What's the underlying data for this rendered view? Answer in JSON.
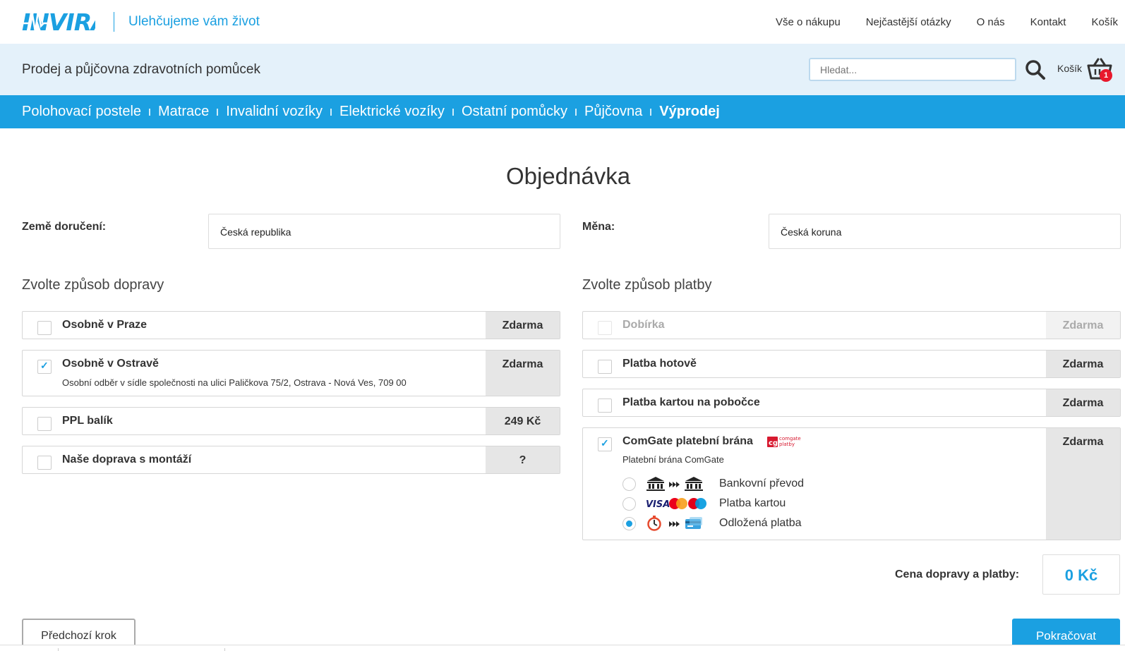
{
  "header": {
    "logo_text": "INVIRA",
    "tagline": "Ulehčujeme vám život",
    "topnav": [
      "Vše o nákupu",
      "Nejčastější otázky",
      "O nás",
      "Kontakt",
      "Košík"
    ]
  },
  "subheader": {
    "title": "Prodej a půjčovna zdravotních pomůcek",
    "search_placeholder": "Hledat...",
    "cart_label": "Košík",
    "cart_count": "1"
  },
  "categories": [
    "Polohovací postele",
    "Matrace",
    "Invalidní vozíky",
    "Elektrické vozíky",
    "Ostatní pomůcky",
    "Půjčovna",
    "Výprodej"
  ],
  "page": {
    "title": "Objednávka",
    "country_label": "Země doručení:",
    "country_value": "Česká republika",
    "currency_label": "Měna:",
    "currency_value": "Česká koruna"
  },
  "shipping": {
    "title": "Zvolte způsob dopravy",
    "options": [
      {
        "name": "Osobně v Praze",
        "price": "Zdarma",
        "checked": false
      },
      {
        "name": "Osobně v Ostravě",
        "price": "Zdarma",
        "checked": true,
        "desc": "Osobní odběr v sídle společnosti na ulici Paličkova 75/2, Ostrava - Nová Ves, 709 00"
      },
      {
        "name": "PPL balík",
        "price": "249 Kč",
        "checked": false
      },
      {
        "name": "Naše doprava s montáží",
        "price": "?",
        "checked": false
      }
    ]
  },
  "payment": {
    "title": "Zvolte způsob platby",
    "options": [
      {
        "name": "Dobírka",
        "price": "Zdarma",
        "checked": false,
        "disabled": true
      },
      {
        "name": "Platba hotově",
        "price": "Zdarma",
        "checked": false
      },
      {
        "name": "Platba kartou na pobočce",
        "price": "Zdarma",
        "checked": false
      },
      {
        "name": "ComGate platební brána",
        "price": "Zdarma",
        "checked": true,
        "desc": "Platební brána ComGate",
        "logo_text": "comgate platby"
      }
    ],
    "comgate_methods": [
      {
        "label": "Bankovní převod",
        "selected": false,
        "icon": "bank-transfer-icon"
      },
      {
        "label": "Platba kartou",
        "selected": false,
        "icon": "card-brands-icon"
      },
      {
        "label": "Odložená platba",
        "selected": true,
        "icon": "deferred-payment-icon"
      }
    ]
  },
  "summary": {
    "label": "Cena dopravy a platby:",
    "value": "0 Kč"
  },
  "buttons": {
    "prev": "Předchozí krok",
    "next": "Pokračovat"
  },
  "colors": {
    "brand": "#1ba0e1",
    "badge": "#e8182c"
  }
}
